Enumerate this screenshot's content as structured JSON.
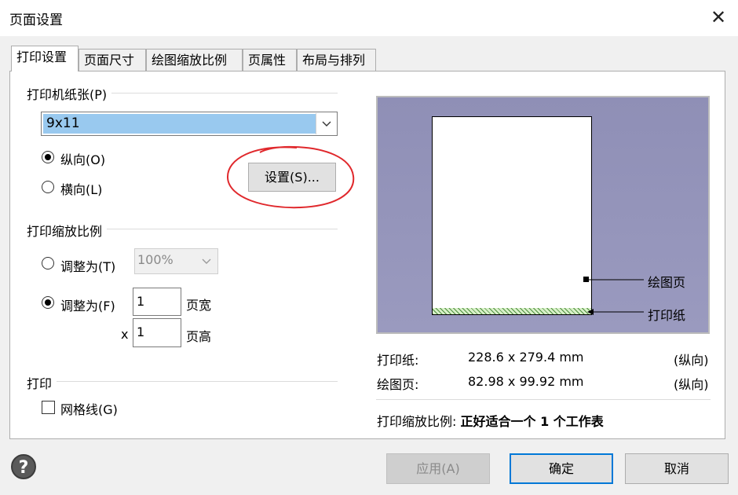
{
  "window": {
    "title": "页面设置",
    "close_glyph": "✕"
  },
  "tabs": [
    {
      "label": "打印设置",
      "active": true
    },
    {
      "label": "页面尺寸",
      "active": false
    },
    {
      "label": "绘图缩放比例",
      "active": false
    },
    {
      "label": "页属性",
      "active": false
    },
    {
      "label": "布局与排列",
      "active": false
    }
  ],
  "paper": {
    "group_label": "打印机纸张(P)",
    "selected": "9x11",
    "portrait_label": "纵向(O)",
    "landscape_label": "横向(L)",
    "orientation": "portrait",
    "setup_button": "设置(S)..."
  },
  "scale": {
    "group_label": "打印缩放比例",
    "adjust_to_label": "调整为(T)",
    "adjust_to_value": "100%",
    "fit_to_label": "调整为(F)",
    "fit_width_value": "1",
    "fit_width_unit": "页宽",
    "x_symbol": "x",
    "fit_height_value": "1",
    "fit_height_unit": "页高",
    "mode": "fit"
  },
  "print": {
    "group_label": "打印",
    "gridlines_label": "网格线(G)",
    "gridlines_checked": false
  },
  "preview": {
    "drawing_page_label": "绘图页",
    "paper_label": "打印纸"
  },
  "info": {
    "paper_key": "打印纸:",
    "paper_value": "228.6 x 279.4 mm",
    "paper_orient": "(纵向)",
    "drawing_key": "绘图页:",
    "drawing_value": "82.98 x 99.92 mm",
    "drawing_orient": "(纵向)",
    "scale_key": "打印缩放比例:",
    "scale_value": "正好适合一个 1 个工作表"
  },
  "footer": {
    "help_glyph": "?",
    "apply": "应用(A)",
    "ok": "确定",
    "cancel": "取消"
  },
  "colors": {
    "accent": "#0078d7",
    "selection": "#99c9ef",
    "annotation": "#e0282c"
  }
}
